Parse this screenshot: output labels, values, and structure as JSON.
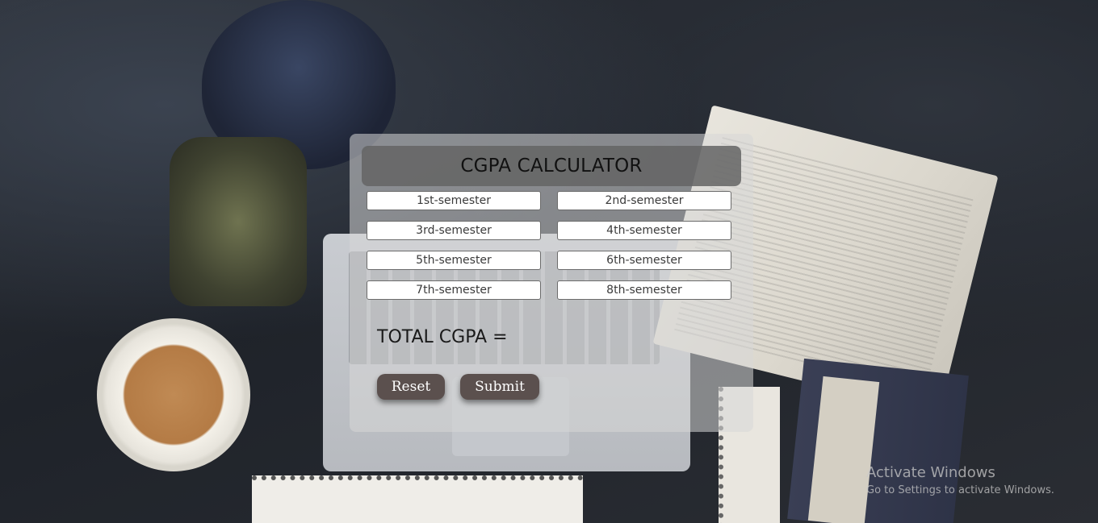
{
  "app": {
    "title": "CGPA CALCULATOR"
  },
  "semesters": [
    {
      "placeholder": "1st-semester",
      "value": ""
    },
    {
      "placeholder": "2nd-semester",
      "value": ""
    },
    {
      "placeholder": "3rd-semester",
      "value": ""
    },
    {
      "placeholder": "4th-semester",
      "value": ""
    },
    {
      "placeholder": "5th-semester",
      "value": ""
    },
    {
      "placeholder": "6th-semester",
      "value": ""
    },
    {
      "placeholder": "7th-semester",
      "value": ""
    },
    {
      "placeholder": "8th-semester",
      "value": ""
    }
  ],
  "result": {
    "label": "TOTAL CGPA ="
  },
  "actions": {
    "reset_label": "Reset",
    "submit_label": "Submit"
  },
  "watermark": {
    "title": "Activate Windows",
    "subtitle": "Go to Settings to activate Windows."
  }
}
